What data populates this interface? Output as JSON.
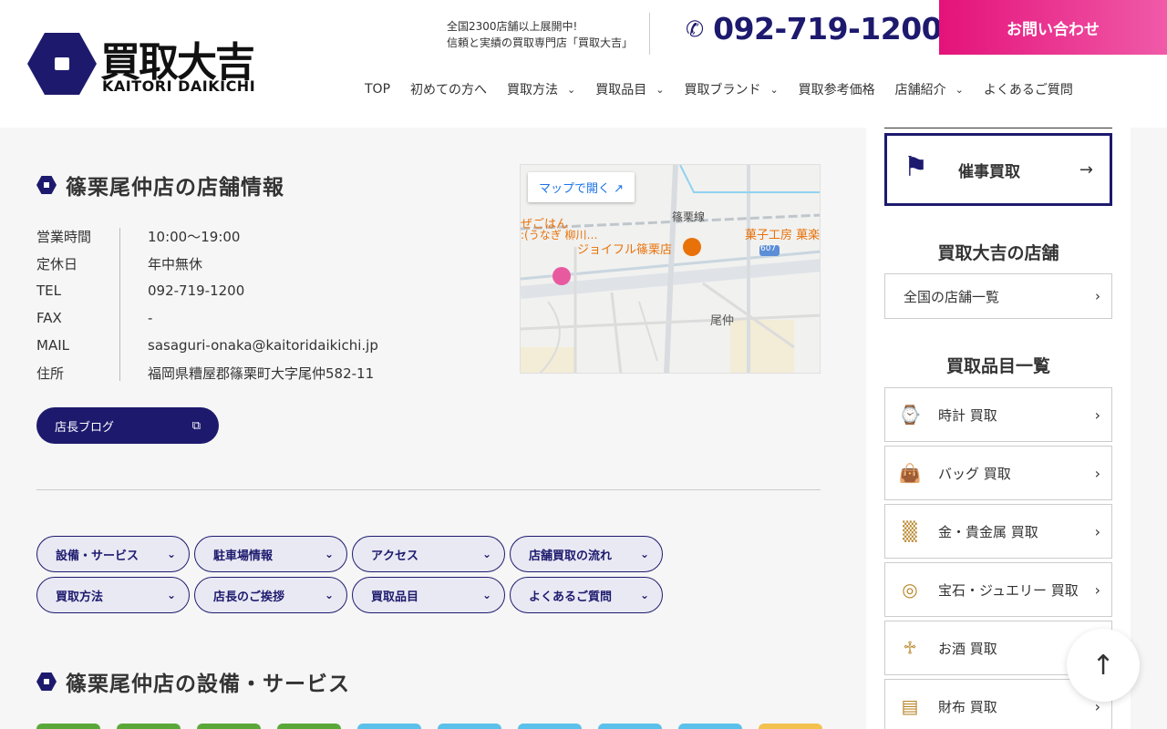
{
  "header": {
    "logo_jp": "買取大吉",
    "logo_en": "KAITORI DAIKICHI",
    "tagline_1": "全国2300店舗以上展開中!",
    "tagline_2": "信頼と実績の買取専門店「買取大吉」",
    "phone": "092-719-1200",
    "contact_label": "お問い合わせ"
  },
  "nav": [
    {
      "label": "TOP",
      "dropdown": false
    },
    {
      "label": "初めての方へ",
      "dropdown": false
    },
    {
      "label": "買取方法",
      "dropdown": true
    },
    {
      "label": "買取品目",
      "dropdown": true
    },
    {
      "label": "買取ブランド",
      "dropdown": true
    },
    {
      "label": "買取参考価格",
      "dropdown": false
    },
    {
      "label": "店舗紹介",
      "dropdown": true
    },
    {
      "label": "よくあるご質問",
      "dropdown": false
    }
  ],
  "store": {
    "title": "篠栗尾仲店の店舗情報",
    "rows": [
      {
        "label": "営業時間",
        "value": "10:00〜19:00"
      },
      {
        "label": "定休日",
        "value": "年中無休"
      },
      {
        "label": "TEL",
        "value": "092-719-1200"
      },
      {
        "label": "FAX",
        "value": "-"
      },
      {
        "label": "MAIL",
        "value": "sasaguri-onaka@kaitoridaikichi.jp"
      },
      {
        "label": "住所",
        "value": "福岡県糟屋郡篠栗町大字尾仲582-11"
      }
    ],
    "blog_label": "店長ブログ"
  },
  "map": {
    "open_label": "マップで開く",
    "labels": {
      "line": "篠栗線",
      "shop": "ジョイフル篠栗店",
      "sweets": "菓子工房 菓楽",
      "eel": "ぜごはん",
      "eel2": ":(うなぎ 柳川…",
      "route": "607",
      "area": "尾仲"
    }
  },
  "pills": [
    "設備・サービス",
    "駐車場情報",
    "アクセス",
    "店舗買取の流れ",
    "買取方法",
    "店長のご挨拶",
    "買取品目",
    "よくあるご質問"
  ],
  "facilities_title": "篠栗尾仲店の設備・サービス",
  "tile_colors": [
    "#5aa83a",
    "#5aa83a",
    "#5aa83a",
    "#5aa83a",
    "#5bc0ea",
    "#5bc0ea",
    "#5bc0ea",
    "#5bc0ea",
    "#5bc0ea",
    "#f2c14e"
  ],
  "sidebar": {
    "event_label": "催事買取",
    "stores_heading": "買取大吉の店舗",
    "stores_link": "全国の店舗一覧",
    "items_heading": "買取品目一覧",
    "items": [
      {
        "label": "時計 買取",
        "icon": "watch-icon"
      },
      {
        "label": "バッグ 買取",
        "icon": "bag-icon"
      },
      {
        "label": "金・貴金属 買取",
        "icon": "gold-bars-icon"
      },
      {
        "label": "宝石・ジュエリー 買取",
        "icon": "jewelry-icon"
      },
      {
        "label": "お酒 買取",
        "icon": "bottle-icon"
      },
      {
        "label": "財布 買取",
        "icon": "wallet-icon"
      }
    ]
  },
  "colors": {
    "brand": "#1d1a6e",
    "accent": "#e4127a"
  }
}
